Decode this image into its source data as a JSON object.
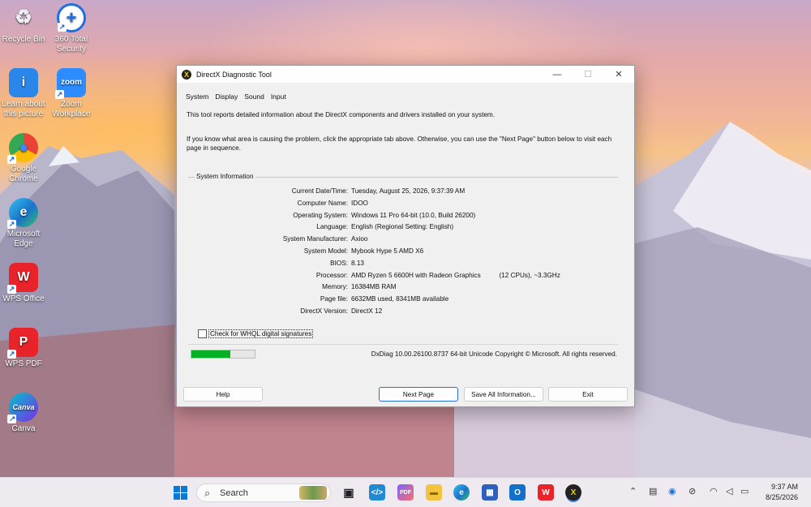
{
  "desktop": {
    "icons": [
      {
        "label": "Recycle Bin",
        "glyph": "♻"
      },
      {
        "label": "360 Total Security",
        "glyph": "+"
      },
      {
        "label": "Learn about this picture",
        "glyph": "i"
      },
      {
        "label": "Zoom Workplace",
        "glyph": "zoom"
      },
      {
        "label": "Google Chrome",
        "glyph": "●"
      },
      {
        "label": "Microsoft Edge",
        "glyph": "e"
      },
      {
        "label": "WPS Office",
        "glyph": "W"
      },
      {
        "label": "WPS PDF",
        "glyph": "P"
      },
      {
        "label": "Canva",
        "glyph": "Canva"
      }
    ]
  },
  "dialog": {
    "title": "DirectX Diagnostic Tool",
    "window_controls": {
      "minimize": "—",
      "maximize": "☐",
      "close": "✕"
    },
    "tabs": [
      "System",
      "Display",
      "Sound",
      "Input"
    ],
    "intro_line1": "This tool reports detailed information about the DirectX components and drivers installed on your system.",
    "intro_line2": "If you know what area is causing the problem, click the appropriate tab above.  Otherwise, you can use the \"Next Page\" button below to visit each page in sequence.",
    "group_label": "System Information",
    "info": [
      {
        "key": "Current Date/Time:",
        "value": "Tuesday, August 25, 2026, 9:37:39 AM"
      },
      {
        "key": "Computer Name:",
        "value": "IDOO"
      },
      {
        "key": "Operating System:",
        "value": "Windows 11 Pro 64-bit (10.0, Build 26200)"
      },
      {
        "key": "Language:",
        "value": "English (Regional Setting: English)"
      },
      {
        "key": "System Manufacturer:",
        "value": "Axioo"
      },
      {
        "key": "System Model:",
        "value": "Mybook Hype 5 AMD X6"
      },
      {
        "key": "BIOS:",
        "value": "8.13"
      },
      {
        "key": "Processor:",
        "value": "AMD Ryzen 5 6600H with Radeon Graphics          (12 CPUs), ~3.3GHz"
      },
      {
        "key": "Memory:",
        "value": "16384MB RAM"
      },
      {
        "key": "Page file:",
        "value": "6632MB used, 8341MB available"
      },
      {
        "key": "DirectX Version:",
        "value": "DirectX 12"
      }
    ],
    "whql_checkbox_label": "Check for WHQL digital signatures",
    "progress_fraction": 0.62,
    "dxdiag_version": "DxDiag 10.00.26100.8737 64-bit Unicode  Copyright © Microsoft. All rights reserved.",
    "buttons": {
      "help": "Help",
      "next_page": "Next Page",
      "save_all": "Save All Information...",
      "exit": "Exit"
    }
  },
  "taskbar": {
    "search_placeholder": "Search",
    "clock_time": "9:37 AM",
    "clock_date": "8/25/2026"
  },
  "colors": {
    "progress_green": "#06b025",
    "accent_blue": "#2a6fd6"
  }
}
